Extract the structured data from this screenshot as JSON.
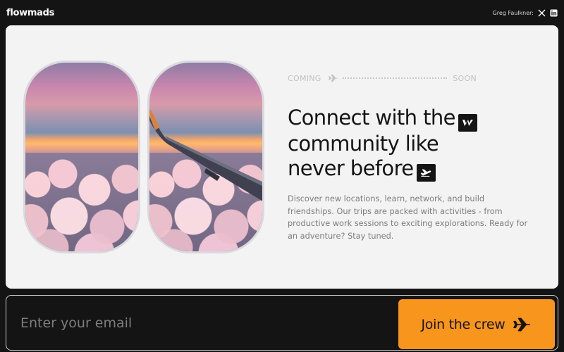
{
  "brand": {
    "name": "flowmads"
  },
  "header": {
    "author": "Greg Faulkner:",
    "social": [
      "x-icon",
      "linkedin-icon"
    ]
  },
  "hero": {
    "coming_label": "COMING",
    "soon_label": "SOON",
    "headline_line1": "Connect with the",
    "headline_line2": "community like",
    "headline_line3": "never before",
    "description": "Discover new locations, learn, network, and build friendships. Our trips are packed with activities - from productive work sessions to exciting explorations. Ready for an adventure? Stay tuned.",
    "images": [
      "sunset-clouds-photo",
      "airplane-wing-photo"
    ]
  },
  "signup": {
    "email_placeholder": "Enter your email",
    "button_label": "Join the crew"
  },
  "colors": {
    "background": "#141414",
    "card": "#f3f3f3",
    "accent": "#f8951d",
    "text_muted": "#7d7d7d"
  }
}
